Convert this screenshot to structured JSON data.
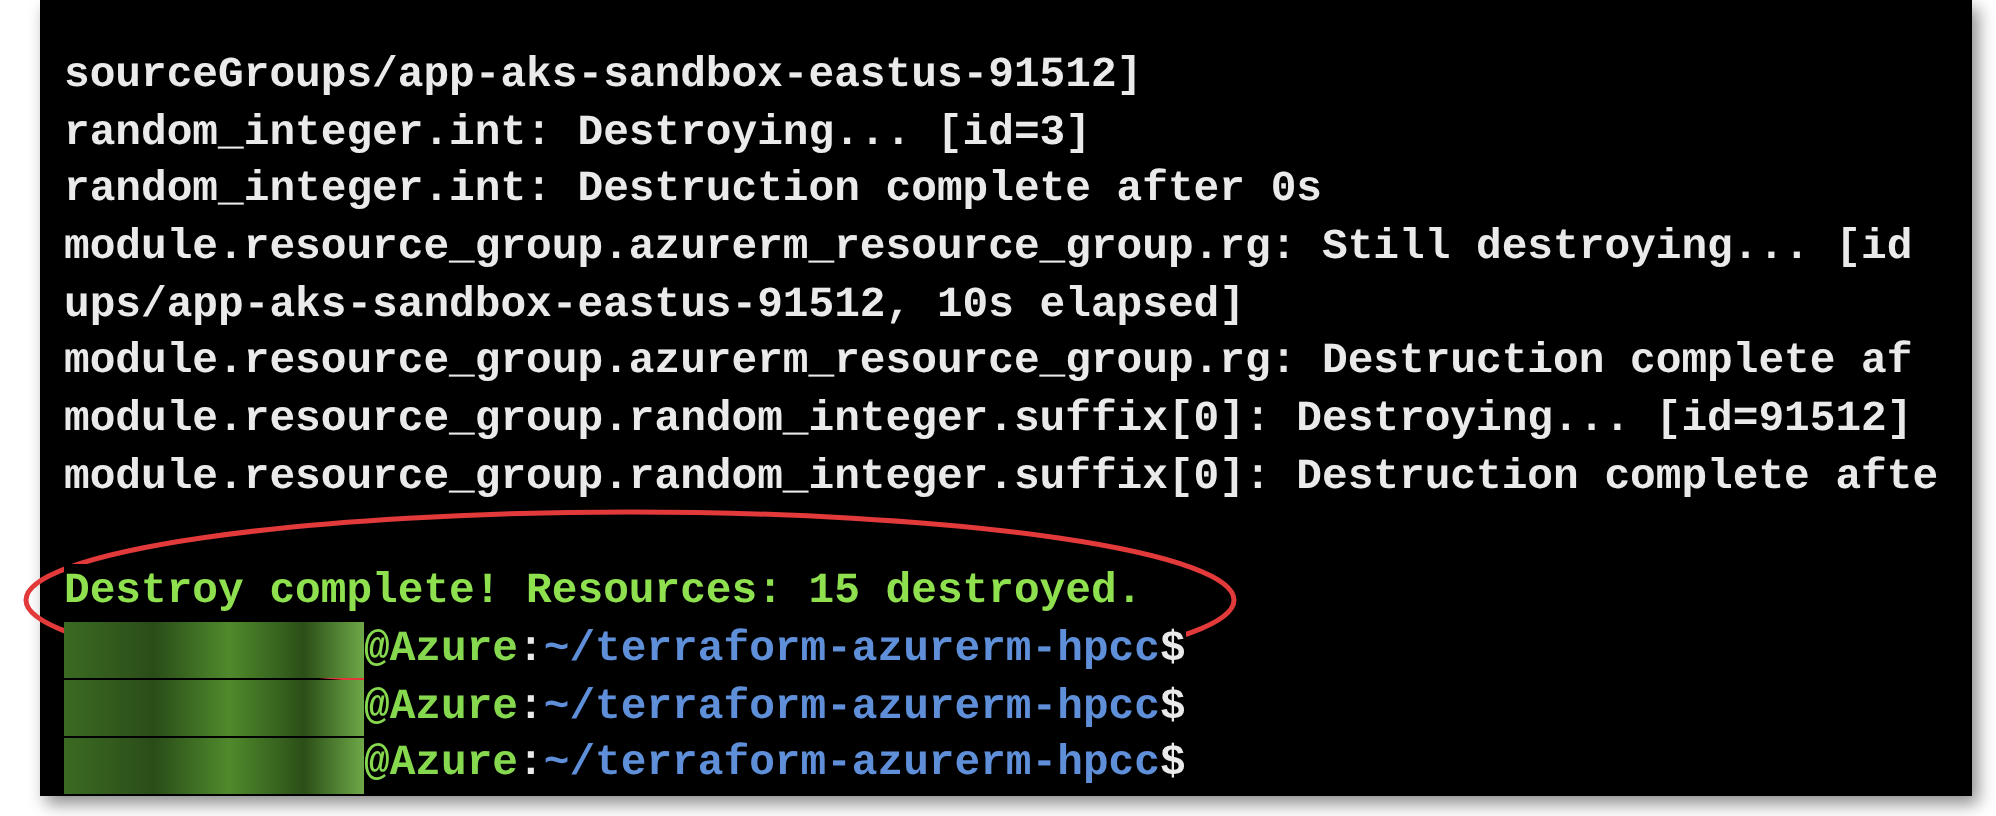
{
  "terminal": {
    "lines": [
      {
        "kind": "output",
        "text": "sourceGroups/app-aks-sandbox-eastus-91512]"
      },
      {
        "kind": "output",
        "text": "random_integer.int: Destroying... [id=3]"
      },
      {
        "kind": "output",
        "text": "random_integer.int: Destruction complete after 0s"
      },
      {
        "kind": "output",
        "text": "module.resource_group.azurerm_resource_group.rg: Still destroying... [id"
      },
      {
        "kind": "output",
        "text": "ups/app-aks-sandbox-eastus-91512, 10s elapsed]"
      },
      {
        "kind": "output",
        "text": "module.resource_group.azurerm_resource_group.rg: Destruction complete af"
      },
      {
        "kind": "output",
        "text": "module.resource_group.random_integer.suffix[0]: Destroying... [id=91512]"
      },
      {
        "kind": "output",
        "text": "module.resource_group.random_integer.suffix[0]: Destruction complete afte"
      },
      {
        "kind": "blank"
      },
      {
        "kind": "success",
        "text": "Destroy complete! Resources: 15 destroyed."
      },
      {
        "kind": "prompt",
        "host": "@Azure",
        "separator": ":",
        "path": "~/terraform-azurerm-hpcc",
        "symbol": "$"
      },
      {
        "kind": "prompt",
        "host": "@Azure",
        "separator": ":",
        "path": "~/terraform-azurerm-hpcc",
        "symbol": "$"
      },
      {
        "kind": "prompt",
        "host": "@Azure",
        "separator": ":",
        "path": "~/terraform-azurerm-hpcc",
        "symbol": "$"
      }
    ]
  },
  "annotations": [
    {
      "kind": "ellipse"
    }
  ]
}
